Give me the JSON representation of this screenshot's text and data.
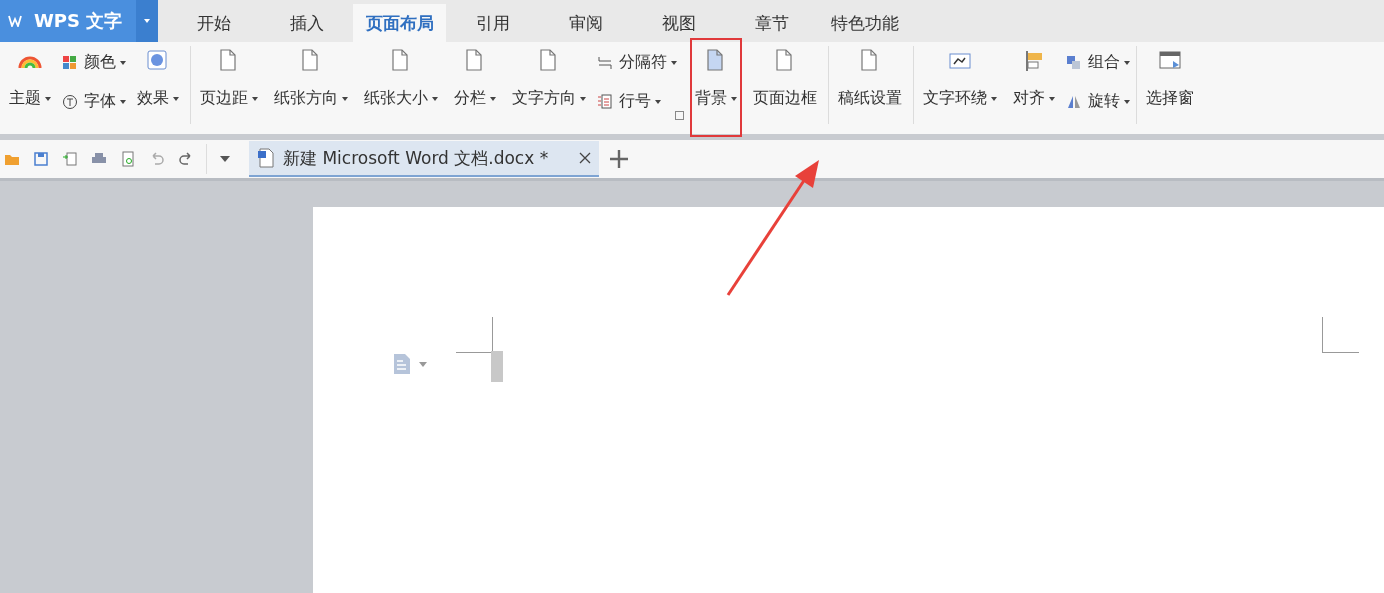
{
  "app_button": {
    "label": "WPS 文字",
    "dropdown": true
  },
  "menu_tabs": [
    {
      "label": "开始",
      "selected": false
    },
    {
      "label": "插入",
      "selected": false
    },
    {
      "label": "页面布局",
      "selected": true
    },
    {
      "label": "引用",
      "selected": false
    },
    {
      "label": "审阅",
      "selected": false
    },
    {
      "label": "视图",
      "selected": false
    },
    {
      "label": "章节",
      "selected": false
    },
    {
      "label": "特色功能",
      "selected": false
    }
  ],
  "ribbon_groups": [
    {
      "items": [
        {
          "kind": "large",
          "label": "主题",
          "dropdown": true,
          "highlighted": false
        },
        {
          "kind": "stack",
          "rows": [
            {
              "label": "颜色",
              "dropdown": true
            },
            {
              "label": "字体",
              "dropdown": true
            }
          ]
        },
        {
          "kind": "large",
          "label": "效果",
          "dropdown": true,
          "highlighted": false
        }
      ]
    },
    {
      "items": [
        {
          "kind": "large",
          "label": "页边距",
          "dropdown": true,
          "highlighted": false
        },
        {
          "kind": "large",
          "label": "纸张方向",
          "dropdown": true,
          "highlighted": false
        },
        {
          "kind": "large",
          "label": "纸张大小",
          "dropdown": true,
          "highlighted": false
        },
        {
          "kind": "large",
          "label": "分栏",
          "dropdown": true,
          "highlighted": false
        },
        {
          "kind": "large",
          "label": "文字方向",
          "dropdown": true,
          "highlighted": false
        },
        {
          "kind": "stack",
          "rows": [
            {
              "label": "分隔符",
              "dropdown": true
            },
            {
              "label": "行号",
              "dropdown": true
            }
          ]
        },
        {
          "kind": "launcher"
        },
        {
          "kind": "large",
          "label": "背景",
          "dropdown": true,
          "highlighted": true
        },
        {
          "kind": "large",
          "label": "页面边框",
          "dropdown": false,
          "highlighted": false
        }
      ]
    },
    {
      "items": [
        {
          "kind": "large",
          "label": "稿纸设置",
          "dropdown": false,
          "highlighted": false
        }
      ]
    },
    {
      "items": [
        {
          "kind": "large",
          "label": "文字环绕",
          "dropdown": true,
          "highlighted": false
        },
        {
          "kind": "large",
          "label": "对齐",
          "dropdown": true,
          "highlighted": false
        },
        {
          "kind": "stack",
          "rows": [
            {
              "label": "组合",
              "dropdown": true
            },
            {
              "label": "旋转",
              "dropdown": true
            }
          ]
        }
      ]
    },
    {
      "items": [
        {
          "kind": "large",
          "label": "选择窗",
          "dropdown": false,
          "highlighted": false
        }
      ]
    }
  ],
  "document_tabs": [
    {
      "title": "新建 Microsoft Word 文档.docx *",
      "selected": true
    }
  ]
}
